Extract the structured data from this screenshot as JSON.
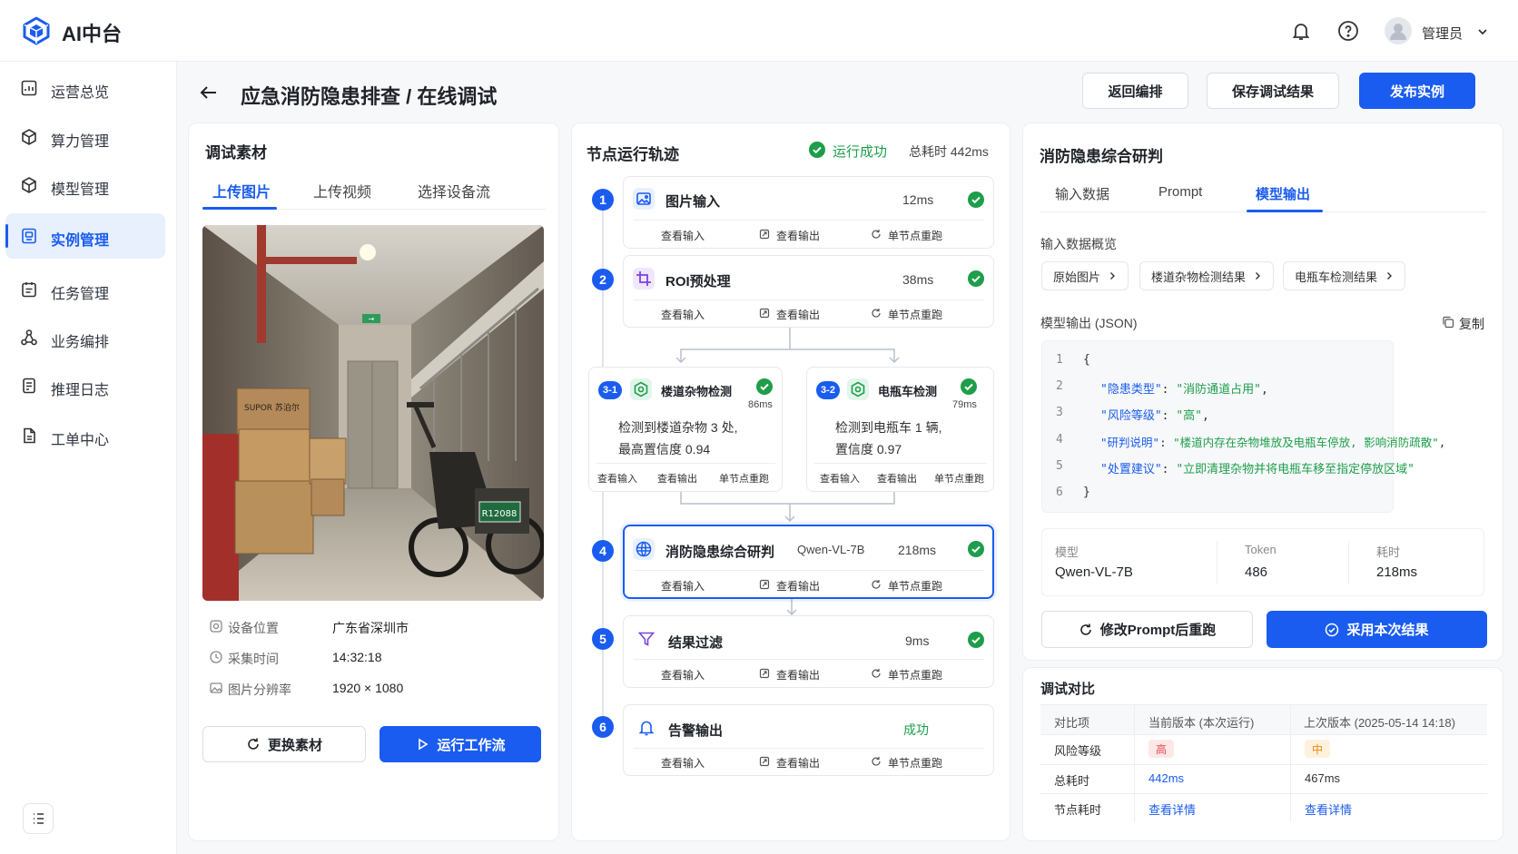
{
  "app": {
    "brand": "AI中台",
    "username": "管理员"
  },
  "sidebar": {
    "items": [
      {
        "label": "运营总览"
      },
      {
        "label": "算力管理"
      },
      {
        "label": "模型管理"
      },
      {
        "label": "实例管理"
      },
      {
        "label": "任务管理"
      },
      {
        "label": "业务编排"
      },
      {
        "label": "推理日志"
      },
      {
        "label": "工单中心"
      }
    ]
  },
  "page": {
    "title": "应急消防隐患排查 / 在线调试",
    "actions": {
      "back_to_edit": "返回编排",
      "save_result": "保存调试结果",
      "publish": "发布实例"
    }
  },
  "material": {
    "title": "调试素材",
    "tabs": [
      "上传图片",
      "上传视频",
      "选择设备流"
    ],
    "meta": [
      {
        "key": "设备位置",
        "value": "广东省深圳市"
      },
      {
        "key": "采集时间",
        "value": "14:32:18"
      },
      {
        "key": "图片分辨率",
        "value": "1920 × 1080"
      }
    ],
    "photo": {
      "exit_sign": "→",
      "plate": "R12088",
      "box_label": "SUPOR 苏泊尔"
    },
    "replace_button": "更换素材",
    "run_button": "运行工作流"
  },
  "trace": {
    "title": "节点运行轨迹",
    "status": "运行成功",
    "total": "总耗时 442ms",
    "actions": {
      "input": "查看输入",
      "output": "查看输出",
      "rerun": "单节点重跑"
    },
    "nodes": [
      {
        "num": "1",
        "name": "图片输入",
        "time": "12ms"
      },
      {
        "num": "2",
        "name": "ROI预处理",
        "time": "38ms"
      },
      {
        "num": "3-1",
        "name": "楼道杂物检测",
        "time": "86ms",
        "desc1": "检测到楼道杂物 3 处,",
        "desc2": "最高置信度 0.94"
      },
      {
        "num": "3-2",
        "name": "电瓶车检测",
        "time": "79ms",
        "desc1": "检测到电瓶车 1 辆,",
        "desc2": "置信度 0.97"
      },
      {
        "num": "4",
        "name": "消防隐患综合研判",
        "model": "Qwen-VL-7B",
        "time": "218ms"
      },
      {
        "num": "5",
        "name": "结果过滤",
        "time": "9ms"
      },
      {
        "num": "6",
        "name": "告警输出",
        "time": "成功"
      }
    ]
  },
  "judge": {
    "title": "消防隐患综合研判",
    "tabs": [
      "输入数据",
      "Prompt",
      "模型输出"
    ],
    "overview_label": "输入数据概览",
    "chips": [
      "原始图片",
      "楼道杂物检测结果",
      "电瓶车检测结果"
    ],
    "output_label": "模型输出 (JSON)",
    "copy": "复制",
    "code": {
      "lines": [
        "1",
        "2",
        "3",
        "4",
        "5",
        "6"
      ],
      "open": "{",
      "close": "}",
      "rows": [
        {
          "k": "\"隐患类型\"",
          "v": "\"消防通道占用\"",
          "end": ","
        },
        {
          "k": "\"风险等级\"",
          "v": "\"高\"",
          "end": ","
        },
        {
          "k": "\"研判说明\"",
          "v": "\"楼道内存在杂物堆放及电瓶车停放, 影响消防疏散\"",
          "end": ","
        },
        {
          "k": "\"处置建议\"",
          "v": "\"立即清理杂物并将电瓶车移至指定停放区域\"",
          "end": ""
        }
      ]
    },
    "stats": [
      {
        "k": "模型",
        "v": "Qwen-VL-7B"
      },
      {
        "k": "Token",
        "v": "486"
      },
      {
        "k": "耗时",
        "v": "218ms"
      }
    ],
    "rerun_button": "修改Prompt后重跑",
    "adopt_button": "采用本次结果"
  },
  "compare": {
    "title": "调试对比",
    "headers": [
      "对比项",
      "当前版本 (本次运行)",
      "上次版本 (2025-05-14 14:18)"
    ],
    "rows": [
      {
        "k": "风险等级",
        "cur": "高",
        "prev": "中"
      },
      {
        "k": "总耗时",
        "cur": "442ms",
        "prev": "467ms"
      },
      {
        "k": "节点耗时",
        "cur": "查看详情",
        "prev": "查看详情"
      }
    ],
    "colors": {
      "high_bg": "#fde8e8",
      "high_fg": "#e5484d",
      "mid_bg": "#fff1de",
      "mid_fg": "#e8890c"
    }
  },
  "theme": {
    "accent": "#1a5cf0",
    "success": "#1e9e4a"
  }
}
